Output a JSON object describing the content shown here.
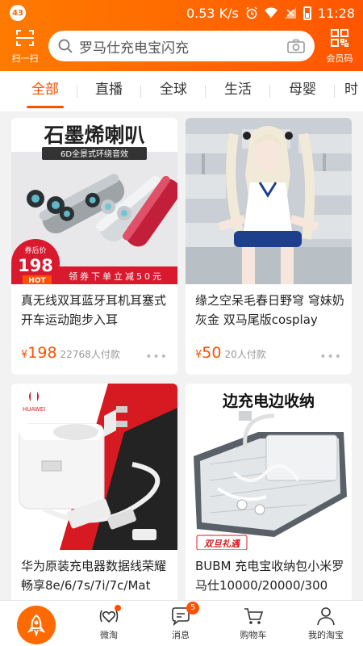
{
  "status_bar": {
    "badge": "43",
    "speed": "0.53 K/s",
    "time": "11:28"
  },
  "header": {
    "scan_label": "扫一扫",
    "search_placeholder": "罗马仕充电宝闪充",
    "member_label": "会员码"
  },
  "tabs": [
    "全部",
    "直播",
    "全球",
    "生活",
    "母婴",
    "时"
  ],
  "active_tab": 0,
  "colors": {
    "accent": "#ff5000",
    "header": "#ff6a00"
  },
  "products": [
    {
      "title": "真无线双耳蓝牙耳机耳塞式开车运动跑步入耳",
      "price_symbol": "¥",
      "price": "198",
      "sold": "22768人付款",
      "more": "•••",
      "image": {
        "headline": "石墨烯喇叭",
        "subline": "6D全景式环绕音效",
        "coupon_label": "券后价",
        "coupon_price": "198",
        "hot_tag": "HOT",
        "banner": "领券下单立减50元"
      }
    },
    {
      "title": "缘之空呆毛春日野穹 穹妹奶灰金 双马尾版cosplay",
      "price_symbol": "¥",
      "price": "50",
      "sold": "20人付款",
      "more": "•••"
    },
    {
      "title": "华为原装充电器数据线荣耀畅享8e/6/7s/7i/7c/Mat",
      "image": {
        "brand": "HUAWEI"
      }
    },
    {
      "title": "BUBM 充电宝收纳包小米罗马仕10000/20000/300",
      "image": {
        "headline": "边充电边收纳",
        "tag": "双旦礼遇"
      }
    }
  ],
  "bottom_nav": [
    {
      "label": "",
      "icon": "taobao-home-icon"
    },
    {
      "label": "微淘",
      "icon": "weitao-icon"
    },
    {
      "label": "消息",
      "icon": "message-icon",
      "badge": "5"
    },
    {
      "label": "购物车",
      "icon": "cart-icon"
    },
    {
      "label": "我的淘宝",
      "icon": "user-icon"
    }
  ]
}
